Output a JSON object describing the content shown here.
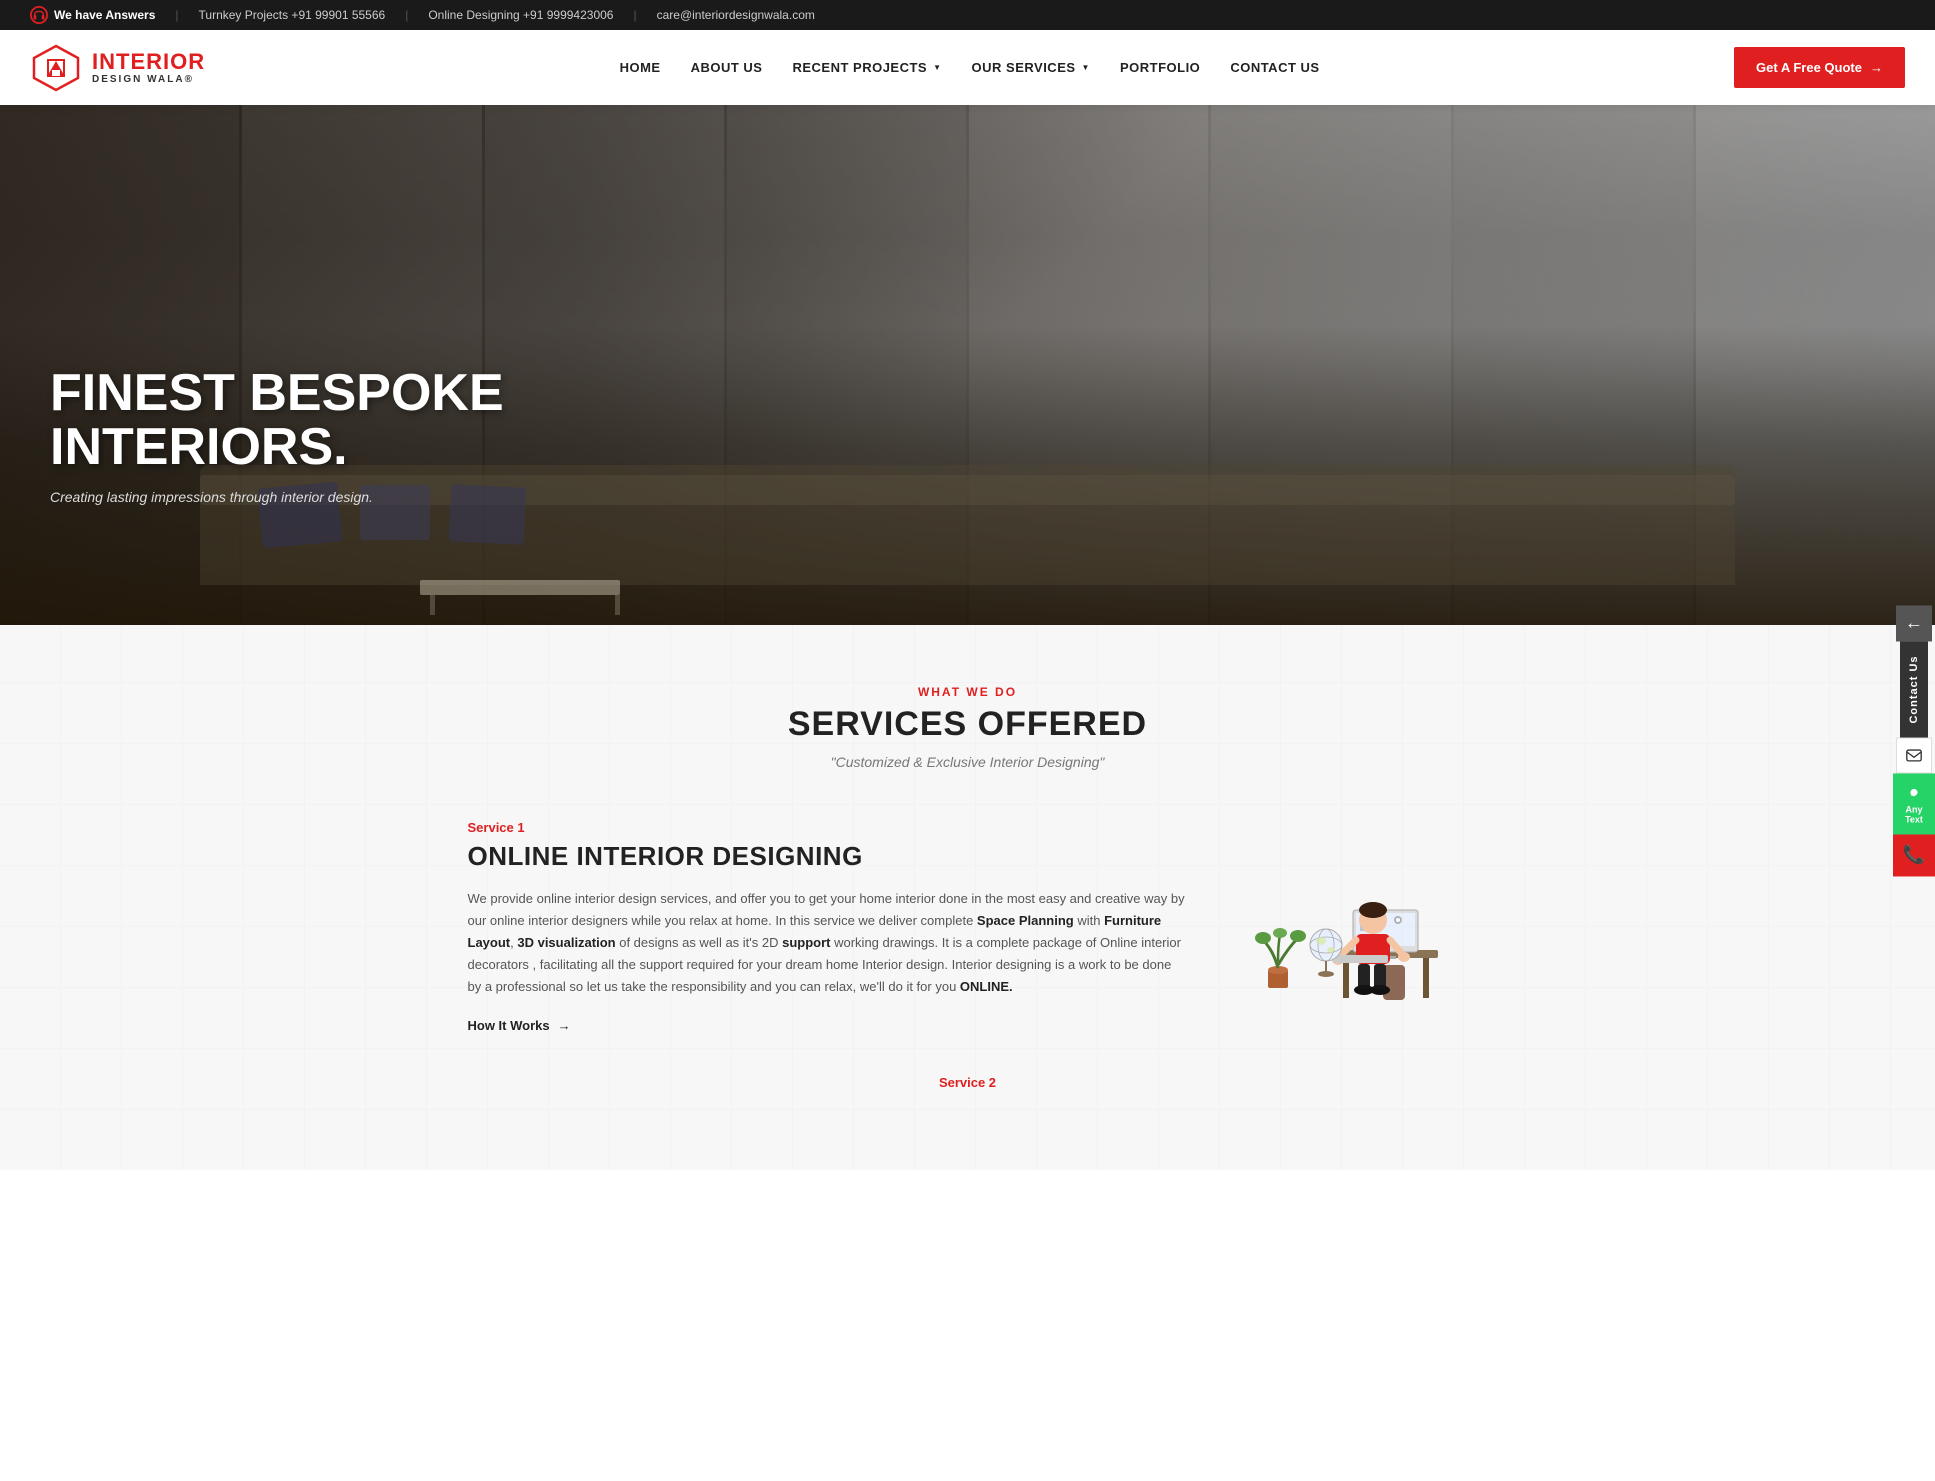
{
  "topbar": {
    "we_have_answers": "We have Answers",
    "phone1_label": "Turnkey Projects +91 99901 55566",
    "phone2_label": "Online Designing +91 9999423006",
    "email_label": "care@interiordesignwala.com"
  },
  "navbar": {
    "brand_name": "INTERIOR",
    "brand_sub1": "DESIGN WALA",
    "brand_sub2": "®",
    "links": [
      {
        "id": "home",
        "label": "HOME",
        "has_dropdown": false
      },
      {
        "id": "about",
        "label": "ABOUT US",
        "has_dropdown": false
      },
      {
        "id": "projects",
        "label": "RECENT PROJECTS",
        "has_dropdown": true
      },
      {
        "id": "services",
        "label": "OUR SERVICES",
        "has_dropdown": true
      },
      {
        "id": "portfolio",
        "label": "PORTFOLIO",
        "has_dropdown": false
      },
      {
        "id": "contact",
        "label": "CONTACT US",
        "has_dropdown": false
      }
    ],
    "cta_label": "Get A Free Quote",
    "cta_arrow": "→"
  },
  "hero": {
    "title_line1": "FINEST BESPOKE",
    "title_line2": "INTERIORS.",
    "subtitle": "Creating lasting impressions through interior design."
  },
  "sidebar": {
    "contact_label": "Contact Us",
    "whatsapp_label": "Any Text",
    "phone_icon": "📞"
  },
  "services": {
    "section_tag": "WHAT WE DO",
    "section_title_bold": "SERVICES",
    "section_title_normal": " OFFERED",
    "section_subtitle": "\"Customized & Exclusive Interior Designing\"",
    "service1": {
      "num": "Service 1",
      "title": "ONLINE INTERIOR DESIGNING",
      "desc_parts": [
        "We provide online interior design services, and offer you to get your home interior done in the most easy and creative way  by our online interior designers while you relax at home. In this service we deliver complete ",
        "Space Planning",
        " with ",
        "Furniture Layout",
        ", ",
        "3D visualization",
        " of designs as well as it's 2D ",
        "support",
        " working drawings. It is a complete package of Online interior decorators , facilitating all the support required for your dream home Interior design. Interior designing is a work to be done by a professional so let us take the responsibility and you can relax, we'll do it for you ",
        "ONLINE."
      ],
      "how_it_works": "How It Works",
      "how_arrow": "→"
    },
    "service2_label": "Service 2"
  },
  "colors": {
    "red": "#e02020",
    "dark": "#1a1a1a",
    "white": "#ffffff"
  }
}
